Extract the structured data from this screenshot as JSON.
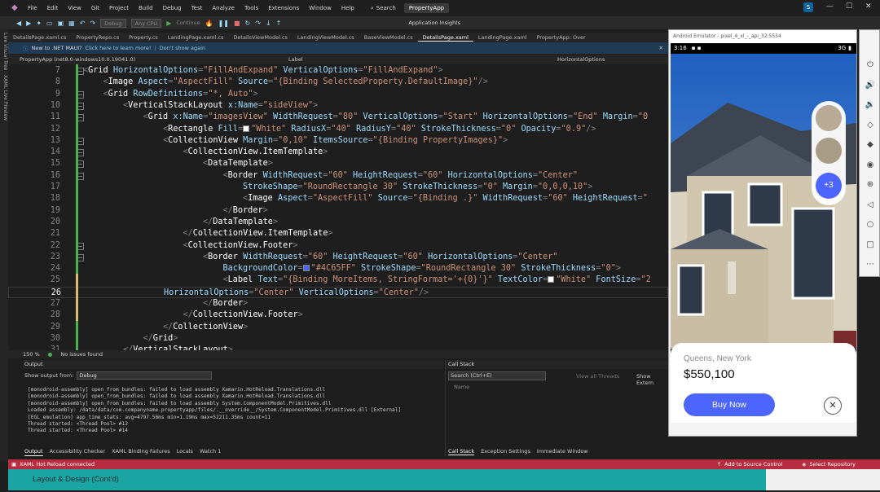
{
  "menu": {
    "items": [
      "File",
      "Edit",
      "View",
      "Git",
      "Project",
      "Build",
      "Debug",
      "Test",
      "Analyze",
      "Tools",
      "Extensions",
      "Window",
      "Help"
    ],
    "search_label": "Search",
    "project_name": "PropertyApp",
    "avatar_initial": "S"
  },
  "toolbar": {
    "config": "Debug",
    "cpu": "Any CPU",
    "continue_label": "Continue",
    "insights": "Application Insights"
  },
  "left_strip": {
    "labels": [
      "Live Visual Tree",
      "XAML Live Preview"
    ]
  },
  "tabs": [
    {
      "label": "DetailsPage.xaml.cs",
      "active": false
    },
    {
      "label": "PropertyRepo.cs",
      "active": false
    },
    {
      "label": "Property.cs",
      "active": false
    },
    {
      "label": "LandingPage.xaml.cs",
      "active": false
    },
    {
      "label": "DetailsViewModel.cs",
      "active": false
    },
    {
      "label": "LandingViewModel.cs",
      "active": false
    },
    {
      "label": "BaseViewModel.cs",
      "active": false
    },
    {
      "label": "DetailsPage.xaml",
      "active": true
    },
    {
      "label": "LandingPage.xaml",
      "active": false
    },
    {
      "label": "PropertyApp: Over",
      "active": false
    }
  ],
  "infobar": {
    "message": "New to .NET MAUI?",
    "learn": "Click here to learn more!",
    "dismiss": "Don't show again"
  },
  "navbar": {
    "left": "PropertyApp (net8.0-windows10.0.19041.0)",
    "mid": "Label",
    "right": "HorizontalOptions"
  },
  "code_lines": [
    {
      "n": "7",
      "indent": 0,
      "parts": [
        [
          "t-pun",
          "<"
        ],
        [
          "t-tag",
          "Grid "
        ],
        [
          "t-attr",
          "HorizontalOptions"
        ],
        [
          "t-pun",
          "="
        ],
        [
          "t-val",
          "\"FillAndExpand\""
        ],
        [
          "t-attr",
          " VerticalOptions"
        ],
        [
          "t-pun",
          "="
        ],
        [
          "t-val",
          "\"FillAndExpand\""
        ],
        [
          "t-pun",
          ">"
        ]
      ]
    },
    {
      "n": "8",
      "indent": 1,
      "parts": [
        [
          "t-pun",
          "<"
        ],
        [
          "t-tag",
          "Image "
        ],
        [
          "t-attr",
          "Aspect"
        ],
        [
          "t-pun",
          "="
        ],
        [
          "t-val",
          "\"AspectFill\""
        ],
        [
          "t-attr",
          " Source"
        ],
        [
          "t-pun",
          "="
        ],
        [
          "t-val",
          "\"{Binding SelectedProperty.DefaultImage}\""
        ],
        [
          "t-pun",
          "/>"
        ]
      ]
    },
    {
      "n": "9",
      "indent": 1,
      "parts": [
        [
          "t-pun",
          "<"
        ],
        [
          "t-tag",
          "Grid "
        ],
        [
          "t-attr",
          "RowDefinitions"
        ],
        [
          "t-pun",
          "="
        ],
        [
          "t-val",
          "\"*, Auto\""
        ],
        [
          "t-pun",
          ">"
        ]
      ]
    },
    {
      "n": "10",
      "indent": 2,
      "parts": [
        [
          "t-pun",
          "<"
        ],
        [
          "t-tag",
          "VerticalStackLayout "
        ],
        [
          "t-attr",
          "x:Name"
        ],
        [
          "t-pun",
          "="
        ],
        [
          "t-val",
          "\"sideView\""
        ],
        [
          "t-pun",
          ">"
        ]
      ]
    },
    {
      "n": "11",
      "indent": 3,
      "parts": [
        [
          "t-pun",
          "<"
        ],
        [
          "t-tag",
          "Grid "
        ],
        [
          "t-attr",
          "x:Name"
        ],
        [
          "t-pun",
          "="
        ],
        [
          "t-val",
          "\"imagesView\""
        ],
        [
          "t-attr",
          " WidthRequest"
        ],
        [
          "t-pun",
          "="
        ],
        [
          "t-val",
          "\"80\""
        ],
        [
          "t-attr",
          " VerticalOptions"
        ],
        [
          "t-pun",
          "="
        ],
        [
          "t-val",
          "\"Start\""
        ],
        [
          "t-attr",
          " HorizontalOptions"
        ],
        [
          "t-pun",
          "="
        ],
        [
          "t-val",
          "\"End\""
        ],
        [
          "t-attr",
          " Margin"
        ],
        [
          "t-pun",
          "="
        ],
        [
          "t-val",
          "\"0"
        ]
      ]
    },
    {
      "n": "12",
      "indent": 4,
      "parts": [
        [
          "t-pun",
          "<"
        ],
        [
          "t-tag",
          "Rectangle "
        ],
        [
          "t-attr",
          "Fill"
        ],
        [
          "t-pun",
          "="
        ],
        [
          "swatch",
          "#ffffff"
        ],
        [
          "t-val",
          "\"White\""
        ],
        [
          "t-attr",
          " RadiusX"
        ],
        [
          "t-pun",
          "="
        ],
        [
          "t-val",
          "\"40\""
        ],
        [
          "t-attr",
          " RadiusY"
        ],
        [
          "t-pun",
          "="
        ],
        [
          "t-val",
          "\"40\""
        ],
        [
          "t-attr",
          " StrokeThickness"
        ],
        [
          "t-pun",
          "="
        ],
        [
          "t-val",
          "\"0\""
        ],
        [
          "t-attr",
          " Opacity"
        ],
        [
          "t-pun",
          "="
        ],
        [
          "t-val",
          "\"0.9\""
        ],
        [
          "t-pun",
          "/>"
        ]
      ]
    },
    {
      "n": "13",
      "indent": 4,
      "parts": [
        [
          "t-pun",
          "<"
        ],
        [
          "t-tag",
          "CollectionView "
        ],
        [
          "t-attr",
          "Margin"
        ],
        [
          "t-pun",
          "="
        ],
        [
          "t-val",
          "\"0,10\""
        ],
        [
          "t-attr",
          " ItemsSource"
        ],
        [
          "t-pun",
          "="
        ],
        [
          "t-val",
          "\"{Binding PropertyImages}\""
        ],
        [
          "t-pun",
          ">"
        ]
      ]
    },
    {
      "n": "14",
      "indent": 5,
      "parts": [
        [
          "t-pun",
          "<"
        ],
        [
          "t-tag",
          "CollectionView.ItemTemplate"
        ],
        [
          "t-pun",
          ">"
        ]
      ]
    },
    {
      "n": "15",
      "indent": 6,
      "parts": [
        [
          "t-pun",
          "<"
        ],
        [
          "t-tag",
          "DataTemplate"
        ],
        [
          "t-pun",
          ">"
        ]
      ]
    },
    {
      "n": "16",
      "indent": 7,
      "parts": [
        [
          "t-pun",
          "<"
        ],
        [
          "t-tag",
          "Border "
        ],
        [
          "t-attr",
          "WidthRequest"
        ],
        [
          "t-pun",
          "="
        ],
        [
          "t-val",
          "\"60\""
        ],
        [
          "t-attr",
          " HeightRequest"
        ],
        [
          "t-pun",
          "="
        ],
        [
          "t-val",
          "\"60\""
        ],
        [
          "t-attr",
          " HorizontalOptions"
        ],
        [
          "t-pun",
          "="
        ],
        [
          "t-val",
          "\"Center\""
        ]
      ]
    },
    {
      "n": "17",
      "indent": 8,
      "parts": [
        [
          "t-attr",
          "StrokeShape"
        ],
        [
          "t-pun",
          "="
        ],
        [
          "t-val",
          "\"RoundRectangle 30\""
        ],
        [
          "t-attr",
          " StrokeThickness"
        ],
        [
          "t-pun",
          "="
        ],
        [
          "t-val",
          "\"0\""
        ],
        [
          "t-attr",
          " Margin"
        ],
        [
          "t-pun",
          "="
        ],
        [
          "t-val",
          "\"0,0,0,10\""
        ],
        [
          "t-pun",
          ">"
        ]
      ]
    },
    {
      "n": "18",
      "indent": 8,
      "parts": [
        [
          "t-pun",
          "<"
        ],
        [
          "t-tag",
          "Image "
        ],
        [
          "t-attr",
          "Aspect"
        ],
        [
          "t-pun",
          "="
        ],
        [
          "t-val",
          "\"AspectFill\""
        ],
        [
          "t-attr",
          " Source"
        ],
        [
          "t-pun",
          "="
        ],
        [
          "t-val",
          "\"{Binding .}\""
        ],
        [
          "t-attr",
          " WidthRequest"
        ],
        [
          "t-pun",
          "="
        ],
        [
          "t-val",
          "\"60\""
        ],
        [
          "t-attr",
          " HeightRequest"
        ],
        [
          "t-pun",
          "="
        ],
        [
          "t-val",
          "\""
        ]
      ]
    },
    {
      "n": "19",
      "indent": 7,
      "parts": [
        [
          "t-pun",
          "</"
        ],
        [
          "t-tag",
          "Border"
        ],
        [
          "t-pun",
          ">"
        ]
      ]
    },
    {
      "n": "20",
      "indent": 6,
      "parts": [
        [
          "t-pun",
          "</"
        ],
        [
          "t-tag",
          "DataTemplate"
        ],
        [
          "t-pun",
          ">"
        ]
      ]
    },
    {
      "n": "21",
      "indent": 5,
      "parts": [
        [
          "t-pun",
          "</"
        ],
        [
          "t-tag",
          "CollectionView.ItemTemplate"
        ],
        [
          "t-pun",
          ">"
        ]
      ]
    },
    {
      "n": "22",
      "indent": 5,
      "parts": [
        [
          "t-pun",
          "<"
        ],
        [
          "t-tag",
          "CollectionView.Footer"
        ],
        [
          "t-pun",
          ">"
        ]
      ]
    },
    {
      "n": "23",
      "indent": 6,
      "parts": [
        [
          "t-pun",
          "<"
        ],
        [
          "t-tag",
          "Border "
        ],
        [
          "t-attr",
          "WidthRequest"
        ],
        [
          "t-pun",
          "="
        ],
        [
          "t-val",
          "\"60\""
        ],
        [
          "t-attr",
          " HeightRequest"
        ],
        [
          "t-pun",
          "="
        ],
        [
          "t-val",
          "\"60\""
        ],
        [
          "t-attr",
          " HorizontalOptions"
        ],
        [
          "t-pun",
          "="
        ],
        [
          "t-val",
          "\"Center\""
        ]
      ]
    },
    {
      "n": "24",
      "indent": 7,
      "parts": [
        [
          "t-attr",
          "BackgroundColor"
        ],
        [
          "t-pun",
          "="
        ],
        [
          "swatch",
          "#4C65FF"
        ],
        [
          "t-val",
          "\"#4C65FF\""
        ],
        [
          "t-attr",
          " StrokeShape"
        ],
        [
          "t-pun",
          "="
        ],
        [
          "t-val",
          "\"RoundRectangle 30\""
        ],
        [
          "t-attr",
          " StrokeThickness"
        ],
        [
          "t-pun",
          "="
        ],
        [
          "t-val",
          "\"0\""
        ],
        [
          "t-pun",
          ">"
        ]
      ]
    },
    {
      "n": "25",
      "indent": 7,
      "parts": [
        [
          "t-pun",
          "<"
        ],
        [
          "t-tag",
          "Label "
        ],
        [
          "t-attr",
          "Text"
        ],
        [
          "t-pun",
          "="
        ],
        [
          "t-val",
          "\"{Binding MoreItems, StringFormat='+{0}'}\""
        ],
        [
          "t-attr",
          " TextColor"
        ],
        [
          "t-pun",
          "="
        ],
        [
          "swatch",
          "#ffffff"
        ],
        [
          "t-val",
          "\"White\""
        ],
        [
          "t-attr",
          " FontSize"
        ],
        [
          "t-pun",
          "="
        ],
        [
          "t-val",
          "\"2"
        ]
      ]
    },
    {
      "n": "26",
      "indent": 4,
      "cur": true,
      "parts": [
        [
          "t-attr",
          "HorizontalOptions"
        ],
        [
          "t-pun",
          "="
        ],
        [
          "t-val",
          "\"Center\""
        ],
        [
          "t-attr",
          " VerticalOptions"
        ],
        [
          "t-pun",
          "="
        ],
        [
          "t-val",
          "\"Center\""
        ],
        [
          "t-pun",
          "/>"
        ]
      ]
    },
    {
      "n": "27",
      "indent": 6,
      "parts": [
        [
          "t-pun",
          "</"
        ],
        [
          "t-tag",
          "Border"
        ],
        [
          "t-pun",
          ">"
        ]
      ]
    },
    {
      "n": "28",
      "indent": 5,
      "parts": [
        [
          "t-pun",
          "</"
        ],
        [
          "t-tag",
          "CollectionView.Footer"
        ],
        [
          "t-pun",
          ">"
        ]
      ]
    },
    {
      "n": "29",
      "indent": 4,
      "parts": [
        [
          "t-pun",
          "</"
        ],
        [
          "t-tag",
          "CollectionView"
        ],
        [
          "t-pun",
          ">"
        ]
      ]
    },
    {
      "n": "30",
      "indent": 3,
      "parts": [
        [
          "t-pun",
          "</"
        ],
        [
          "t-tag",
          "Grid"
        ],
        [
          "t-pun",
          ">"
        ]
      ]
    },
    {
      "n": "31",
      "indent": 2,
      "parts": [
        [
          "t-pun",
          "</"
        ],
        [
          "t-tag",
          "VerticalStackLayout"
        ],
        [
          "t-pun",
          ">"
        ]
      ]
    }
  ],
  "editor_status": {
    "zoom": "150 %",
    "issues": "No issues found"
  },
  "output": {
    "title": "Output",
    "show_from_label": "Show output from:",
    "source": "Debug",
    "lines": [
      "[monodroid-assembly] open_from_bundles: failed to load assembly Xamarin.HotReload.Translations.dll",
      "[monodroid-assembly] open_from_bundles: failed to load assembly Xamarin.HotReload.Translations.dll",
      "[monodroid-assembly] open_from_bundles: failed to load assembly System.ComponentModel.Primitives.dll",
      "Loaded assembly: /data/data/com.companyname.propertyapp/files/.__override__/System.ComponentModel.Primitives.dll [External]",
      "[EGL_emulation] app_time_stats: avg=4797.56ms min=1.19ms max=52211.35ms count=11",
      "Thread started: <Thread Pool> #13",
      "Thread started: <Thread Pool> #14"
    ],
    "tabs": [
      "Output",
      "Accessibility Checker",
      "XAML Binding Failures",
      "Locals",
      "Watch 1"
    ]
  },
  "callstack": {
    "title": "Call Stack",
    "search_placeholder": "Search (Ctrl+E)",
    "view_threads": "View all Threads",
    "show_external": "Show Extern",
    "col_name": "Name",
    "tabs": [
      "Call Stack",
      "Exception Settings",
      "Immediate Window"
    ]
  },
  "statusbar": {
    "left": "XAML Hot Reload connected",
    "source_control": "Add to Source Control",
    "repo": "Select Repository"
  },
  "caption": "Layout & Design (Cont'd)",
  "emulator": {
    "title": "Android Emulator - pixel_4_xl_-_api_32:5554",
    "time": "3:16",
    "network": "3G",
    "more_count": "+3",
    "location": "Queens, New York",
    "price": "$550,100",
    "buy_label": "Buy Now",
    "close_glyph": "✕",
    "accent": "#4C65FF"
  },
  "emulator_side_icons": [
    "power-icon",
    "volume-up-icon",
    "volume-down-icon",
    "rotate-left-icon",
    "rotate-right-icon",
    "camera-icon",
    "zoom-icon",
    "back-icon",
    "home-icon",
    "overview-icon",
    "more-icon"
  ]
}
